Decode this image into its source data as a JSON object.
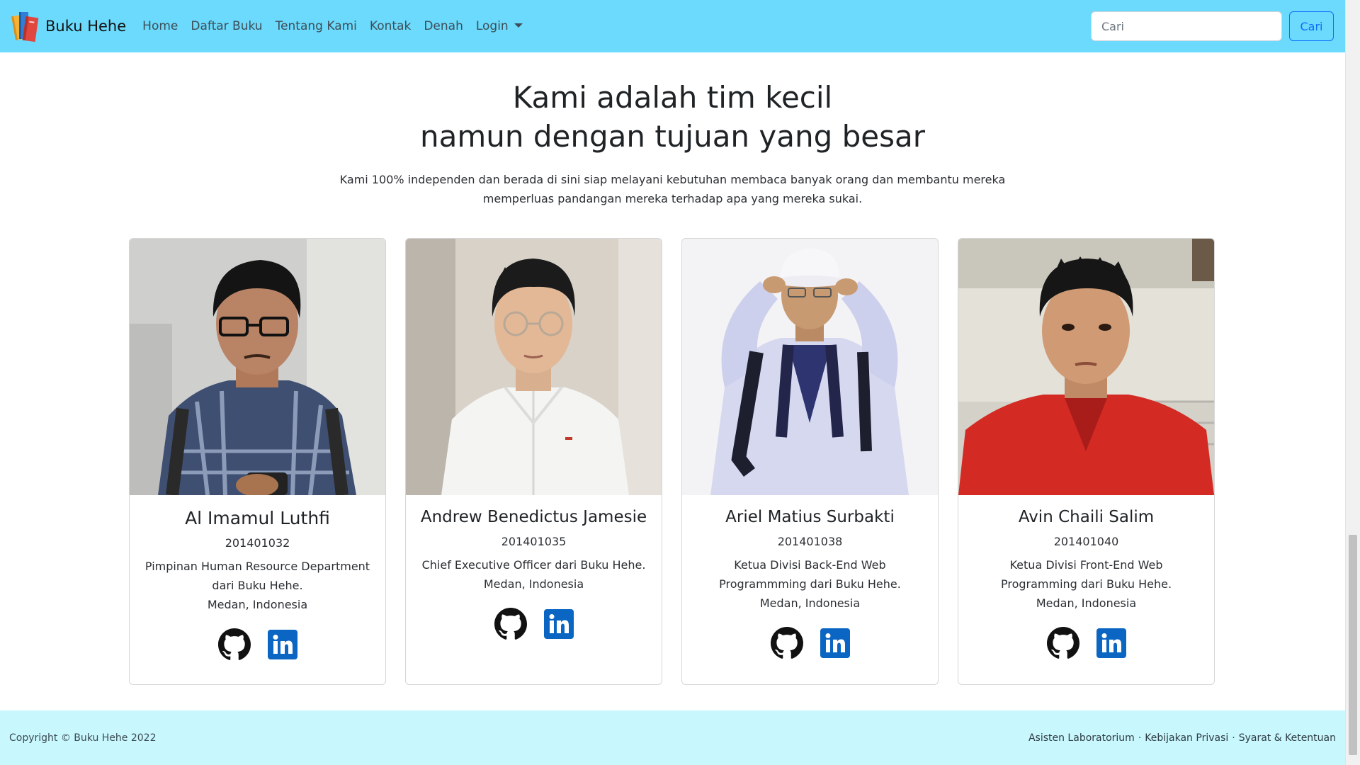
{
  "navbar": {
    "brand": "Buku Hehe",
    "links": [
      "Home",
      "Daftar Buku",
      "Tentang Kami",
      "Kontak",
      "Denah"
    ],
    "login_label": "Login",
    "search_placeholder": "Cari",
    "search_button": "Cari"
  },
  "hero": {
    "title_line1": "Kami adalah tim kecil",
    "title_line2": "namun dengan tujuan yang besar",
    "description": "Kami 100% independen dan berada di sini siap melayani kebutuhan membaca banyak orang dan membantu mereka memperluas pandangan mereka terhadap apa yang mereka sukai."
  },
  "team": [
    {
      "name": "Al Imamul Luthfi",
      "id": "201401032",
      "role": "Pimpinan Human Resource Department dari Buku Hehe.",
      "location": "Medan, Indonesia"
    },
    {
      "name": "Andrew Benedictus Jamesie",
      "id": "201401035",
      "role": "Chief Executive Officer dari Buku Hehe.",
      "location": "Medan, Indonesia"
    },
    {
      "name": "Ariel Matius Surbakti",
      "id": "201401038",
      "role": "Ketua Divisi Back-End Web Programmming dari Buku Hehe.",
      "location": "Medan, Indonesia"
    },
    {
      "name": "Avin Chaili Salim",
      "id": "201401040",
      "role": "Ketua Divisi Front-End Web Programming dari Buku Hehe.",
      "location": "Medan, Indonesia"
    }
  ],
  "footer": {
    "copyright": "Copyright © Buku Hehe 2022",
    "links": [
      "Asisten Laboratorium",
      "Kebijakan Privasi",
      "Syarat & Ketentuan"
    ],
    "separator": "·"
  },
  "colors": {
    "navbar": "#6bdafc",
    "footer": "#c8f7fd",
    "primary": "#0d6efd",
    "linkedin": "#0a66c2"
  },
  "icons": [
    "book-stack-logo-icon",
    "github-icon",
    "linkedin-icon",
    "chevron-down-icon"
  ]
}
